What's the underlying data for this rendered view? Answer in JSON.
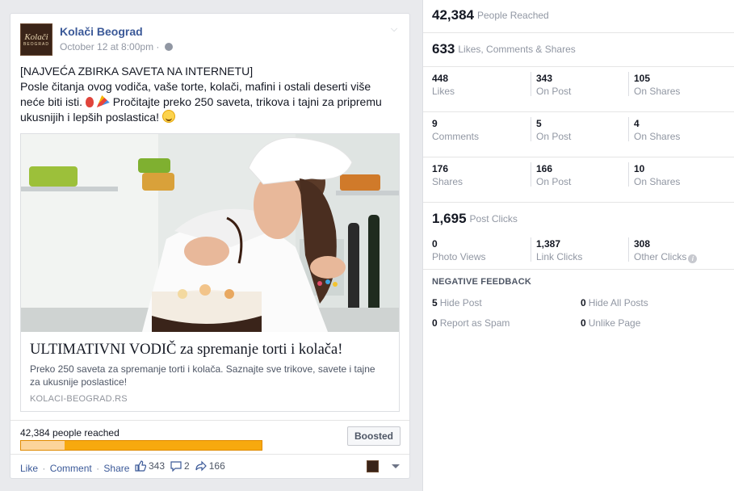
{
  "post": {
    "page_name": "Kolači Beograd",
    "logo_text": "Kolači",
    "logo_subtext": "BEOGRAD",
    "time": "October 12 at 8:00pm",
    "text_line1": "[NAJVEĆA ZBIRKA SAVETA NA INTERNETU]",
    "text_line2": "Posle čitanja ovog vodiča, vaše torte, kolači, mafini i ostali deserti više",
    "text_line3_a": "neće biti isti.",
    "text_line3_b": "Pročitajte preko 250 saveta, trikova i tajni za pripremu",
    "text_line4": "ukusnijih i lepših poslastica!",
    "link_title": "ULTIMATIVNI VODIČ za spremanje torti i kolača!",
    "link_desc": "Preko 250 saveta za spremanje torti i kolača. Saznajte sve trikove, savete i tajne za ukusnije poslastice!",
    "link_domain": "KOLACI-BEOGRAD.RS",
    "reach_text": "42,384 people reached",
    "boosted_label": "Boosted",
    "actions": {
      "like": "Like",
      "comment": "Comment",
      "share": "Share",
      "sep": "·"
    },
    "counts": {
      "likes": "343",
      "comments": "2",
      "shares": "166"
    },
    "icons": [
      "globe-icon",
      "chevron-down-icon",
      "balloon-icon",
      "party-popper-icon",
      "smile-icon",
      "thumbs-up-icon",
      "comment-icon",
      "share-icon",
      "caret-down-icon"
    ]
  },
  "insights": {
    "reached": {
      "value": "42,384",
      "label": "People Reached"
    },
    "engagement": {
      "value": "633",
      "label": "Likes, Comments & Shares"
    },
    "likes_row": [
      {
        "num": "448",
        "label": "Likes"
      },
      {
        "num": "343",
        "label": "On Post"
      },
      {
        "num": "105",
        "label": "On Shares"
      }
    ],
    "comments_row": [
      {
        "num": "9",
        "label": "Comments"
      },
      {
        "num": "5",
        "label": "On Post"
      },
      {
        "num": "4",
        "label": "On Shares"
      }
    ],
    "shares_row": [
      {
        "num": "176",
        "label": "Shares"
      },
      {
        "num": "166",
        "label": "On Post"
      },
      {
        "num": "10",
        "label": "On Shares"
      }
    ],
    "clicks": {
      "value": "1,695",
      "label": "Post Clicks"
    },
    "clicks_row": [
      {
        "num": "0",
        "label": "Photo Views"
      },
      {
        "num": "1,387",
        "label": "Link Clicks"
      },
      {
        "num": "308",
        "label": "Other Clicks"
      }
    ],
    "negative": {
      "title": "NEGATIVE FEEDBACK",
      "items": [
        {
          "num": "5",
          "label": "Hide Post"
        },
        {
          "num": "0",
          "label": "Hide All Posts"
        },
        {
          "num": "0",
          "label": "Report as Spam"
        },
        {
          "num": "0",
          "label": "Unlike Page"
        }
      ]
    }
  },
  "colors": {
    "link": "#3b5998",
    "paid_reach": "#f7a90e",
    "organic_reach": "#fcd49b",
    "muted": "#9197a3"
  }
}
